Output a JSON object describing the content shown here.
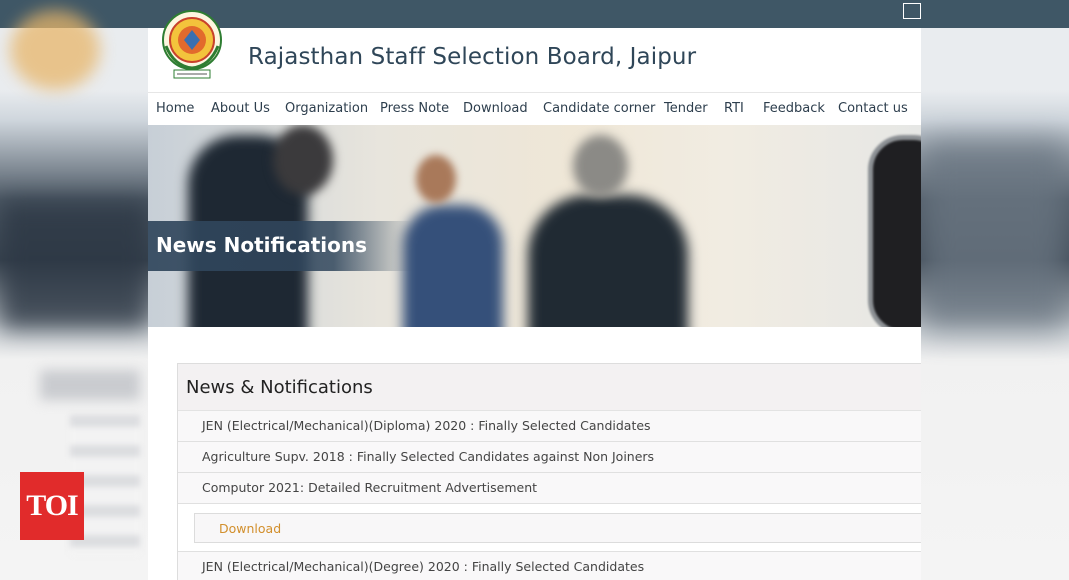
{
  "site": {
    "title": "Rajasthan Staff Selection Board, Jaipur"
  },
  "nav": {
    "items": [
      {
        "label": "Home"
      },
      {
        "label": "About Us"
      },
      {
        "label": "Organization"
      },
      {
        "label": "Press Note"
      },
      {
        "label": "Download"
      },
      {
        "label": "Candidate corner"
      },
      {
        "label": "Tender"
      },
      {
        "label": "RTI"
      },
      {
        "label": "Feedback"
      },
      {
        "label": "Contact us"
      }
    ]
  },
  "banner": {
    "title": "News Notifications"
  },
  "news": {
    "title": "News & Notifications",
    "items": [
      {
        "text": "JEN (Electrical/Mechanical)(Diploma) 2020 : Finally Selected Candidates"
      },
      {
        "text": "Agriculture Supv. 2018 : Finally Selected Candidates against Non Joiners"
      },
      {
        "text": "Computor 2021: Detailed Recruitment Advertisement"
      },
      {
        "text": "JEN (Electrical/Mechanical)(Degree) 2020 : Finally Selected Candidates"
      }
    ],
    "download_label": "Download"
  },
  "watermark": {
    "text": "TOI"
  },
  "colors": {
    "topbar": "#3f5766",
    "accent_link": "#d28f2c",
    "title_text": "#2f4658",
    "badge": "#e12b2b"
  },
  "icons": [
    "emblem-logo-icon",
    "window-box-icon"
  ]
}
